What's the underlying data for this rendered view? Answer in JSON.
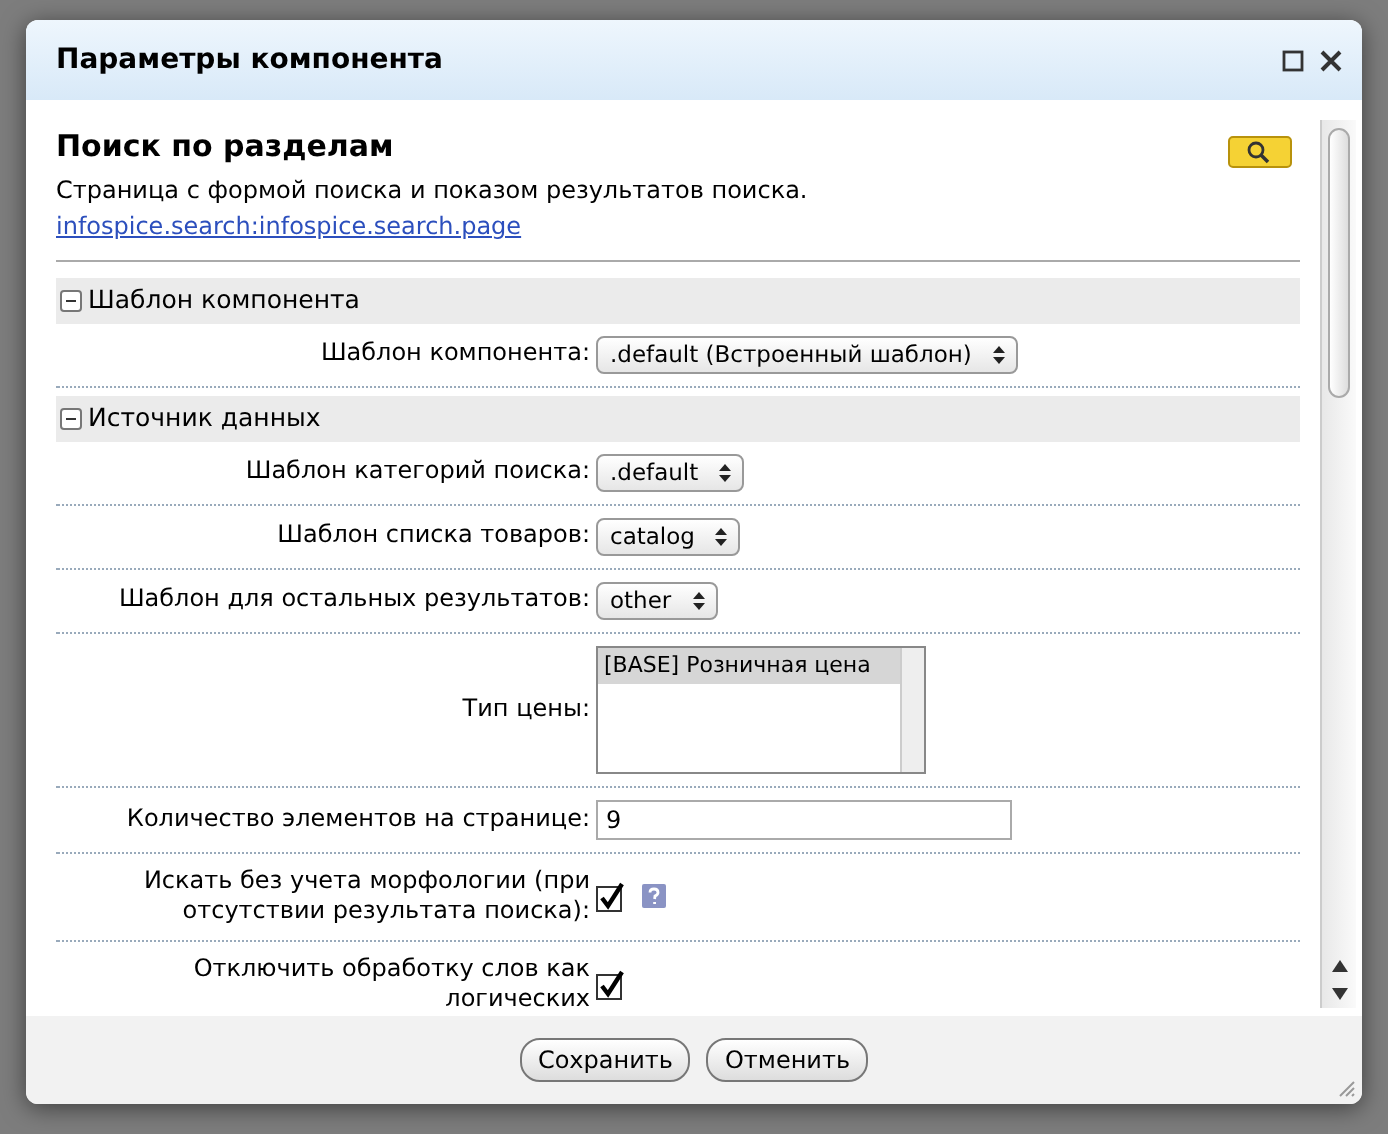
{
  "dialog": {
    "title": "Параметры компонента"
  },
  "component": {
    "name": "Поиск по разделам",
    "description": "Страница с формой поиска и показом результатов поиска.",
    "link": "infospice.search:infospice.search.page"
  },
  "sections": [
    {
      "title": "Шаблон компонента",
      "expanded": true,
      "fields": [
        {
          "kind": "select",
          "label": "Шаблон компонента:",
          "value": ".default (Встроенный шаблон)"
        }
      ]
    },
    {
      "title": "Источник данных",
      "expanded": true,
      "fields": [
        {
          "kind": "select",
          "label": "Шаблон категорий поиска:",
          "value": ".default"
        },
        {
          "kind": "select",
          "label": "Шаблон списка товаров:",
          "value": "catalog"
        },
        {
          "kind": "select",
          "label": "Шаблон для остальных результатов:",
          "value": "other"
        },
        {
          "kind": "listbox",
          "label": "Тип цены:",
          "options": [
            {
              "label": "[BASE] Розничная цена",
              "selected": true
            }
          ]
        },
        {
          "kind": "text",
          "label": "Количество элементов на странице:",
          "value": "9"
        },
        {
          "kind": "checkbox",
          "label": "Искать без учета морфологии (при отсутствии результата поиска):",
          "checked": true,
          "help": true
        },
        {
          "kind": "checkbox",
          "label": "Отключить обработку слов как логических",
          "checked": true,
          "help": false
        }
      ]
    }
  ],
  "buttons": [
    {
      "label": "Сохранить"
    },
    {
      "label": "Отменить"
    }
  ]
}
